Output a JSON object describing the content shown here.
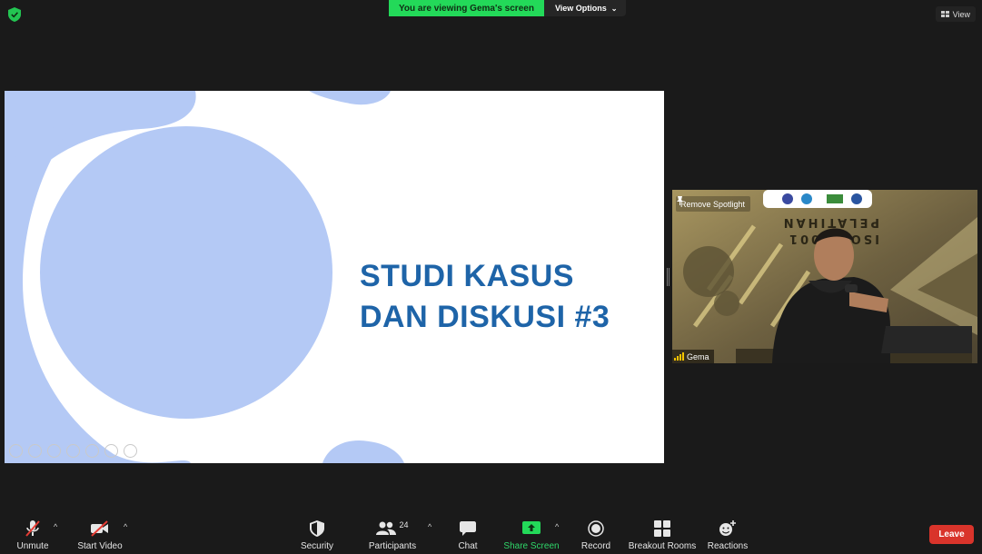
{
  "top_bar": {
    "viewing_label": "You are viewing Gema's screen",
    "view_options_label": "View Options",
    "view_label": "View"
  },
  "slide": {
    "title_line1": "STUDI KASUS",
    "title_line2": "DAN DISKUSI #3",
    "title_color": "#1e64a8",
    "accent_color": "#b4c9f5"
  },
  "video": {
    "spotlight_label": "Remove Spotlight",
    "participant_name": "Gema",
    "background_text_line1": "PELATIHAN",
    "background_text_line2": "ISO 27001"
  },
  "toolbar": {
    "unmute": "Unmute",
    "start_video": "Start Video",
    "security": "Security",
    "participants": "Participants",
    "participants_count": "24",
    "chat": "Chat",
    "share_screen": "Share Screen",
    "record": "Record",
    "breakout_rooms": "Breakout Rooms",
    "reactions": "Reactions",
    "leave": "Leave"
  },
  "colors": {
    "share_green": "#23d959",
    "leave_red": "#d9342b",
    "background": "#1a1a1a"
  }
}
